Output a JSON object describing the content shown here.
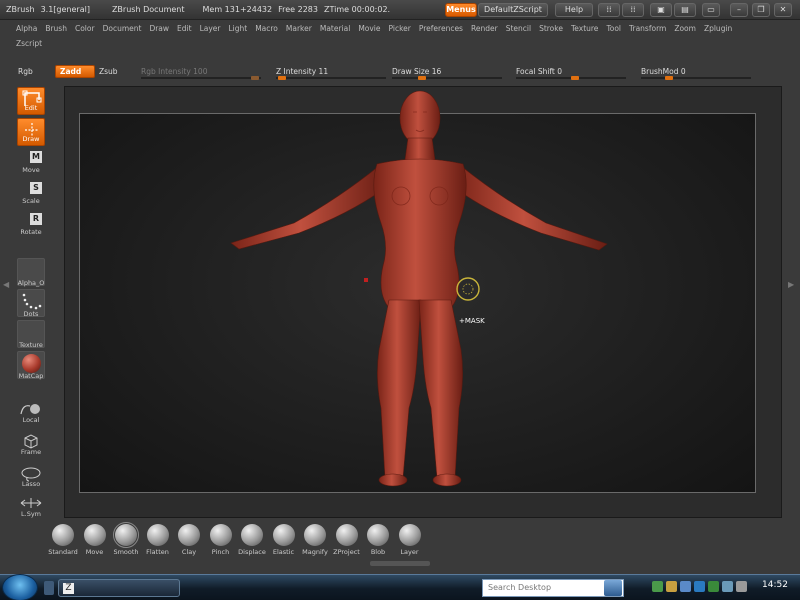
{
  "title_bar": {
    "app_name": "ZBrush",
    "version": "3.1[general]",
    "document": "ZBrush Document",
    "mem": "Mem 131+24432",
    "free": "Free 2283",
    "ztime": "ZTime 00:00:02.",
    "menus_btn": "Menus",
    "default_zscript_btn": "DefaultZScript",
    "help_btn": "Help"
  },
  "menu": {
    "row1": [
      "Alpha",
      "Brush",
      "Color",
      "Document",
      "Draw",
      "Edit",
      "Layer",
      "Light",
      "Macro",
      "Marker",
      "Material",
      "Movie",
      "Picker",
      "Preferences",
      "Render",
      "Stencil",
      "Stroke",
      "Texture",
      "Tool",
      "Transform",
      "Zoom",
      "Zplugin"
    ],
    "row2": [
      "Zscript"
    ]
  },
  "toolstrip": {
    "rgb": "Rgb",
    "zadd": "Zadd",
    "zsub": "Zsub",
    "rgb_intensity": "Rgb Intensity 100",
    "z_intensity": "Z Intensity 11",
    "draw_size": "Draw Size 16",
    "focal_shift": "Focal Shift 0",
    "brush_mod": "BrushMod 0"
  },
  "left_toolbar": {
    "edit": "Edit",
    "draw": "Draw",
    "move": "Move",
    "scale": "Scale",
    "rotate": "Rotate",
    "alpha": "Alpha_O",
    "dots": "Dots",
    "texture": "Texture",
    "matcap": "MatCap",
    "local": "Local",
    "frame": "Frame",
    "lasso": "Lasso",
    "lsym": "L.Sym",
    "move_letter": "M",
    "scale_letter": "S",
    "rotate_letter": "R"
  },
  "canvas": {
    "cursor_label": "+MASK"
  },
  "brushes": [
    "Standard",
    "Move",
    "Smooth",
    "Flatten",
    "Clay",
    "Pinch",
    "Displace",
    "Elastic",
    "Magnify",
    "ZProject",
    "Blob",
    "Layer"
  ],
  "taskbar": {
    "search_placeholder": "Search Desktop",
    "clock": "14:52"
  },
  "colors": {
    "accent": "#e8740e",
    "skin": "#b8473a",
    "viewport_bg": "#1c1c1c"
  }
}
